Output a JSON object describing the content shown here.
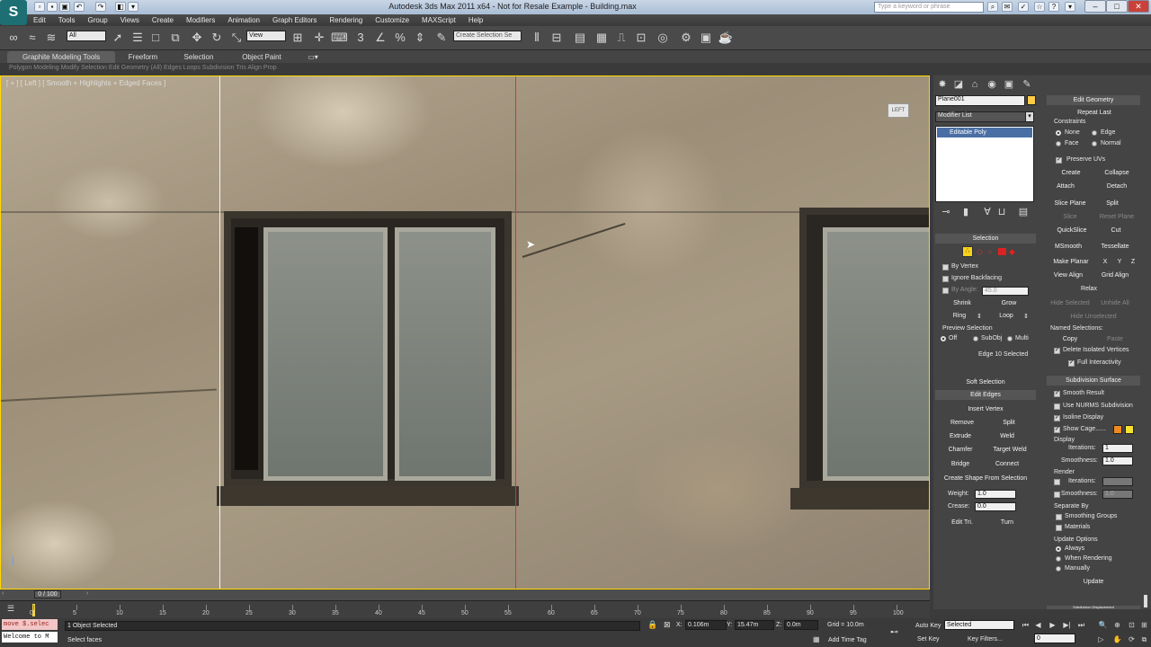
{
  "title": {
    "text": "Autodesk 3ds Max 2011 x64    -  Not for Resale   Example - Building.max",
    "search_placeholder": "Type a keyword or phrase",
    "logo": "3ds-max-logo"
  },
  "menu": [
    "Edit",
    "Tools",
    "Group",
    "Views",
    "Create",
    "Modifiers",
    "Animation",
    "Graph Editors",
    "Rendering",
    "Customize",
    "MAXScript",
    "Help"
  ],
  "toolbar": {
    "selection_filter": "All",
    "ref_coord": "View",
    "named_sel": "Create Selection Se"
  },
  "ribbon": {
    "tabs": [
      "Graphite Modeling Tools",
      "Freeform",
      "Selection",
      "Object Paint"
    ],
    "sub": "Polygon Modeling   Modify Selection   Edit   Geometry (All)   Edges   Loops   Subdivision   Tris   Align   Prop"
  },
  "viewport": {
    "label": "[ + ] [ Left ] [ Smooth + Highlights + Edged Faces ]",
    "cube": "LEFT"
  },
  "cmd": {
    "object_name": "Plane001",
    "modifier_list": "Modifier List",
    "stack_item": "Editable Poly",
    "selection_head": "Selection",
    "by_vertex": "By Vertex",
    "ignore_backfacing": "Ignore Backfacing",
    "by_angle": "By Angle:",
    "by_angle_val": "45.0",
    "shrink": "Shrink",
    "grow": "Grow",
    "ring": "Ring",
    "loop": "Loop",
    "preview_selection": "Preview Selection",
    "off": "Off",
    "subobj": "SubObj",
    "multi": "Multi",
    "edge_selected": "Edge 10 Selected",
    "soft_selection": "Soft Selection",
    "edit_edges": "Edit Edges",
    "insert_vertex": "Insert Vertex",
    "remove": "Remove",
    "split": "Split",
    "extrude": "Extrude",
    "weld": "Weld",
    "chamfer": "Chamfer",
    "target_weld": "Target Weld",
    "bridge": "Bridge",
    "connect": "Connect",
    "create_shape": "Create Shape From Selection",
    "weight": "Weight:",
    "weight_val": "1.0",
    "crease": "Crease:",
    "crease_val": "0.0",
    "edit_tri": "Edit Tri.",
    "turn": "Turn",
    "edit_geometry": "Edit Geometry",
    "repeat_last": "Repeat Last",
    "constraints": "Constraints",
    "none": "None",
    "edge": "Edge",
    "face": "Face",
    "normal": "Normal",
    "preserve_uvs": "Preserve UVs",
    "create": "Create",
    "collapse": "Collapse",
    "attach": "Attach",
    "detach": "Detach",
    "slice_plane": "Slice Plane",
    "split2": "Split",
    "slice": "Slice",
    "reset_plane": "Reset Plane",
    "quickslice": "QuickSlice",
    "cut": "Cut",
    "msmooth": "MSmooth",
    "tessellate": "Tessellate",
    "make_planar": "Make Planar",
    "x": "X",
    "y": "Y",
    "z": "Z",
    "view_align": "View Align",
    "grid_align": "Grid Align",
    "relax": "Relax",
    "hide_selected": "Hide Selected",
    "unhide_all": "Unhide All",
    "hide_unselected": "Hide Unselected",
    "named_selections": "Named Selections:",
    "copy": "Copy",
    "paste": "Paste",
    "delete_isolated": "Delete Isolated Vertices",
    "full_interactivity": "Full Interactivity",
    "subdivision_surface": "Subdivision Surface",
    "smooth_result": "Smooth Result",
    "use_nurms": "Use NURMS Subdivision",
    "isoline_display": "Isoline Display",
    "show_cage": "Show Cage......",
    "display": "Display",
    "iterations": "Iterations:",
    "iter_val": "1",
    "smoothness": "Smoothness:",
    "smooth_val": "1.0",
    "render": "Render",
    "separate_by": "Separate By",
    "smoothing_groups": "Smoothing Groups",
    "materials": "Materials",
    "update_options": "Update Options",
    "always": "Always",
    "when_rendering": "When Rendering",
    "manually": "Manually",
    "update": "Update",
    "subdivision_displacement": "Subdivision Displacement"
  },
  "timeline": {
    "frame": "0 / 100",
    "ticks": [
      "0",
      "5",
      "10",
      "15",
      "20",
      "25",
      "30",
      "35",
      "40",
      "45",
      "50",
      "55",
      "60",
      "65",
      "70",
      "75",
      "80",
      "85",
      "90",
      "95",
      "100"
    ]
  },
  "status": {
    "maxscript1": "move $.selec",
    "maxscript2": "Welcome to M",
    "selected": "1 Object Selected",
    "prompt": "Select faces",
    "x_label": "X:",
    "x": "0.106m",
    "y_label": "Y:",
    "y": "15.47m",
    "z_label": "Z:",
    "z": "0.0m",
    "grid": "Grid = 10.0m",
    "add_time_tag": "Add Time Tag",
    "auto_key": "Auto Key",
    "auto_key_val": "Selected",
    "set_key": "Set Key",
    "key_filters": "Key Filters...",
    "frame_field": "0"
  },
  "colors": {
    "accent_yellow": "#ffd700",
    "edge_red": "#e03030",
    "object_color": "#ffcc44"
  }
}
